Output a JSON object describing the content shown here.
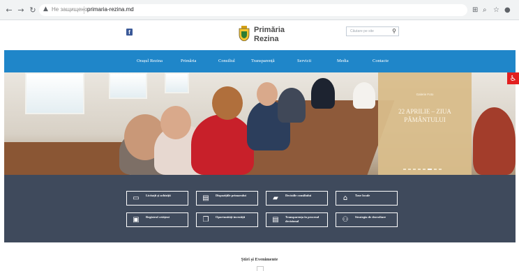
{
  "browser": {
    "security_label": "Не защищено",
    "url": "primaria-rezina.md"
  },
  "header": {
    "logo_line1": "Primăria",
    "logo_line2": "Rezina",
    "search_placeholder": "Căutare pe site",
    "social_icon": "facebook-icon"
  },
  "nav": {
    "items": [
      "Orașul Rezina",
      "Primăria",
      "Consiliul",
      "Transparență",
      "Servicii",
      "Media",
      "Contacte"
    ]
  },
  "hero": {
    "subtitle": "Galerie Foto",
    "title": "22 APRILIE – ZIUA PĂMÂNTULUI"
  },
  "services": {
    "tiles": [
      {
        "label": "Licitații și achiziții",
        "icon": "card-icon"
      },
      {
        "label": "Dispozițiile primarului",
        "icon": "document-icon"
      },
      {
        "label": "Deciziile consiliului",
        "icon": "note-icon"
      },
      {
        "label": "Taxe locale",
        "icon": "bank-icon"
      },
      {
        "label": "Registrul cetățeni",
        "icon": "money-icon"
      },
      {
        "label": "Oportunități investiții",
        "icon": "windows-icon"
      },
      {
        "label": "Transparența în procesul decizional",
        "icon": "document-icon"
      },
      {
        "label": "Strategia de dezvoltare",
        "icon": "handshake-icon"
      }
    ]
  },
  "news": {
    "title": "Știri și Evenimente"
  },
  "colors": {
    "nav_bg": "#1f86c9",
    "services_bg": "#3f4a5c",
    "banner_bg": "#d9bd8b",
    "accessibility": "#e21f1f"
  }
}
